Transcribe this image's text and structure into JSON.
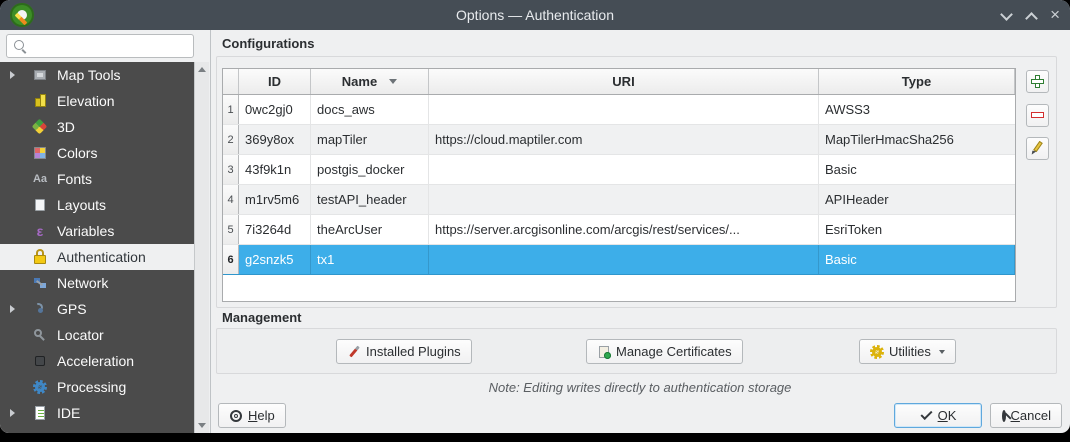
{
  "window": {
    "title": "Options — Authentication"
  },
  "sidebar": {
    "search_value": "",
    "items": [
      {
        "label": "Map Tools",
        "icon": "map-tools-icon",
        "expandable": true,
        "selected": false
      },
      {
        "label": "Elevation",
        "icon": "elevation-icon",
        "expandable": false,
        "selected": false
      },
      {
        "label": "3D",
        "icon": "3d-icon",
        "expandable": false,
        "selected": false
      },
      {
        "label": "Colors",
        "icon": "colors-icon",
        "expandable": false,
        "selected": false
      },
      {
        "label": "Fonts",
        "icon": "fonts-icon",
        "glyph": "Aa",
        "expandable": false,
        "selected": false
      },
      {
        "label": "Layouts",
        "icon": "layouts-icon",
        "expandable": false,
        "selected": false
      },
      {
        "label": "Variables",
        "icon": "variables-icon",
        "glyph": "ε",
        "expandable": false,
        "selected": false
      },
      {
        "label": "Authentication",
        "icon": "lock-icon",
        "expandable": false,
        "selected": true
      },
      {
        "label": "Network",
        "icon": "network-icon",
        "expandable": false,
        "selected": false
      },
      {
        "label": "GPS",
        "icon": "gps-icon",
        "expandable": true,
        "selected": false
      },
      {
        "label": "Locator",
        "icon": "locator-icon",
        "expandable": false,
        "selected": false
      },
      {
        "label": "Acceleration",
        "icon": "acceleration-icon",
        "expandable": false,
        "selected": false
      },
      {
        "label": "Processing",
        "icon": "processing-gear-icon",
        "expandable": false,
        "selected": false
      },
      {
        "label": "IDE",
        "icon": "ide-icon",
        "expandable": true,
        "selected": false
      }
    ]
  },
  "configurations": {
    "label": "Configurations",
    "table": {
      "headers": [
        "ID",
        "Name",
        "URI",
        "Type"
      ],
      "sorted_by": "Name",
      "rows": [
        {
          "num": "1",
          "id": "0wc2gj0",
          "name": "docs_aws",
          "uri": "",
          "type": "AWSS3",
          "selected": false
        },
        {
          "num": "2",
          "id": "369y8ox",
          "name": "mapTiler",
          "uri": "https://cloud.maptiler.com",
          "type": "MapTilerHmacSha256",
          "selected": false
        },
        {
          "num": "3",
          "id": "43f9k1n",
          "name": "postgis_docker",
          "uri": "",
          "type": "Basic",
          "selected": false
        },
        {
          "num": "4",
          "id": "m1rv5m6",
          "name": "testAPI_header",
          "uri": "",
          "type": "APIHeader",
          "selected": false
        },
        {
          "num": "5",
          "id": "7i3264d",
          "name": "theArcUser",
          "uri": "https://server.arcgisonline.com/arcgis/rest/services/...",
          "type": "EsriToken",
          "selected": false
        },
        {
          "num": "6",
          "id": "g2snzk5",
          "name": "tx1",
          "uri": "",
          "type": "Basic",
          "selected": true
        }
      ]
    }
  },
  "management": {
    "label": "Management",
    "installed_plugins": "Installed Plugins",
    "manage_certificates": "Manage Certificates",
    "utilities": "Utilities"
  },
  "footer": {
    "note": "Note: Editing writes directly to authentication storage",
    "help": {
      "accel": "H",
      "rest": "elp"
    },
    "ok": {
      "accel": "O",
      "rest": "K"
    },
    "cancel": {
      "accel": "C",
      "rest": "ancel"
    }
  },
  "colors": {
    "titlebar_bg": "#454d55",
    "sidebar_bg": "#4b4b4b",
    "selection_blue": "#3daee9",
    "dialog_bg": "#eff0f1",
    "lock_yellow": "#f3c913"
  }
}
